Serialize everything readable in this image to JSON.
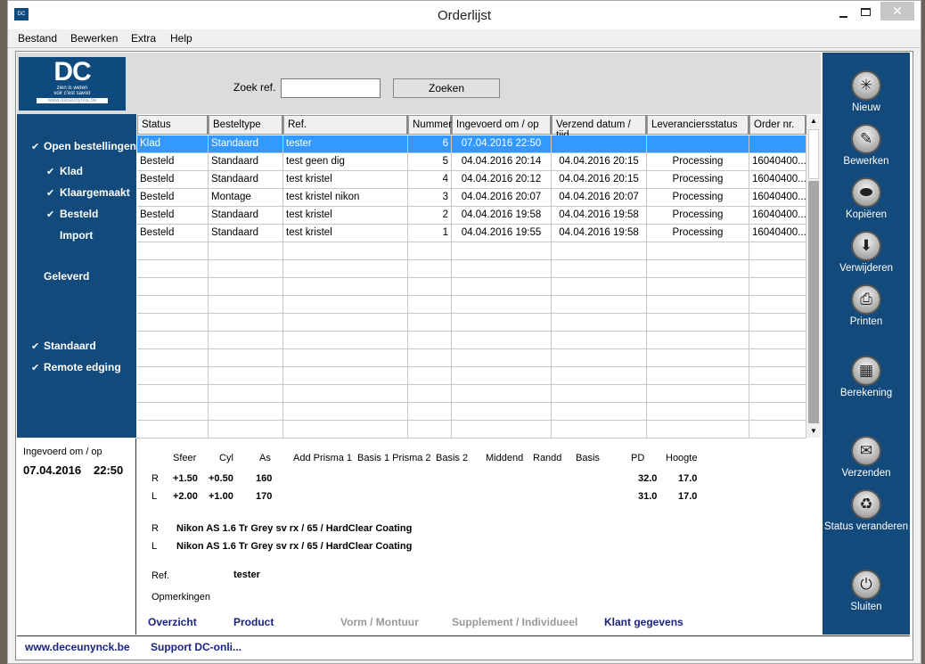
{
  "window": {
    "title": "Orderlijst",
    "app_icon": "DC"
  },
  "menu": [
    "Bestand",
    "Bewerken",
    "Extra",
    "Help"
  ],
  "logo": {
    "text": "DC",
    "tagline1": "zien is weten",
    "tagline2": "voir c'est savoir",
    "url": "www.deceunynck.be"
  },
  "search": {
    "label": "Zoek ref.",
    "value": "",
    "button": "Zoeken"
  },
  "sidebar": {
    "items": [
      {
        "label": "Open bestellingen",
        "checked": true
      },
      {
        "label": "Klad",
        "checked": true
      },
      {
        "label": "Klaargemaakt",
        "checked": true
      },
      {
        "label": "Besteld",
        "checked": true
      },
      {
        "label": "Import",
        "checked": false
      },
      {
        "label": "Geleverd",
        "checked": false
      },
      {
        "label": "Standaard",
        "checked": true
      },
      {
        "label": "Remote edging",
        "checked": true
      }
    ]
  },
  "table": {
    "columns": [
      "Status",
      "Besteltype",
      "Ref.",
      "Nummer",
      "Ingevoerd om / op",
      "Verzend datum / tijd",
      "Leveranciersstatus",
      "Order nr."
    ],
    "rows": [
      [
        "Klad",
        "Standaard",
        "tester",
        "6",
        "07.04.2016   22:50",
        "",
        "",
        ""
      ],
      [
        "Besteld",
        "Standaard",
        "test geen dig",
        "5",
        "04.04.2016   20:14",
        "04.04.2016   20:15",
        "Processing",
        "16040400..."
      ],
      [
        "Besteld",
        "Standaard",
        "test kristel",
        "4",
        "04.04.2016   20:12",
        "04.04.2016   20:15",
        "Processing",
        "16040400..."
      ],
      [
        "Besteld",
        "Montage",
        "test kristel nikon",
        "3",
        "04.04.2016   20:07",
        "04.04.2016   20:07",
        "Processing",
        "16040400..."
      ],
      [
        "Besteld",
        "Standaard",
        "test kristel",
        "2",
        "04.04.2016   19:58",
        "04.04.2016   19:58",
        "Processing",
        "16040400..."
      ],
      [
        "Besteld",
        "Standaard",
        "test kristel",
        "1",
        "04.04.2016   19:55",
        "04.04.2016   19:58",
        "Processing",
        "16040400..."
      ]
    ],
    "selected_row": 0
  },
  "actions": [
    {
      "label": "Nieuw",
      "icon": "new-icon",
      "glyph": "✳"
    },
    {
      "label": "Bewerken",
      "icon": "pencil-icon",
      "glyph": "✎"
    },
    {
      "label": "Kopiëren",
      "icon": "copy-icon",
      "glyph": "⬬"
    },
    {
      "label": "Verwijderen",
      "icon": "delete-icon",
      "glyph": "⬇"
    },
    {
      "label": "Printen",
      "icon": "printer-icon",
      "glyph": "⎙"
    },
    {
      "label": "Berekening",
      "icon": "calculator-icon",
      "glyph": "▦"
    },
    {
      "label": "Verzenden",
      "icon": "envelope-icon",
      "glyph": "✉"
    },
    {
      "label": "Status veranderen",
      "icon": "recycle-icon",
      "glyph": "♻"
    },
    {
      "label": "Sluiten",
      "icon": "power-icon",
      "glyph": "⏻"
    }
  ],
  "detail": {
    "entered_label": "Ingevoerd om / op",
    "entered_date": "07.04.2016",
    "entered_time": "22:50",
    "headers": [
      "Sfeer",
      "Cyl",
      "As",
      "Add Prisma 1",
      "Basis 1 Prisma 2",
      "Basis 2",
      "Middend",
      "Randd",
      "Basis",
      "PD",
      "Hoogte"
    ],
    "R": {
      "side": "R",
      "sfeer": "+1.50",
      "cyl": "+0.50",
      "as": "160",
      "pd": "32.0",
      "hoogte": "17.0"
    },
    "L": {
      "side": "L",
      "sfeer": "+2.00",
      "cyl": "+1.00",
      "as": "170",
      "pd": "31.0",
      "hoogte": "17.0"
    },
    "product_R": "Nikon AS 1.6 Tr Grey sv rx  /  65  /  HardClear Coating",
    "product_L": "Nikon AS 1.6 Tr Grey sv rx  /  65  /  HardClear Coating",
    "ref_label": "Ref.",
    "ref_value": "tester",
    "remarks_label": "Opmerkingen",
    "tabs": [
      {
        "label": "Overzicht",
        "enabled": true
      },
      {
        "label": "Product",
        "enabled": true
      },
      {
        "label": "Vorm / Montuur",
        "enabled": false
      },
      {
        "label": "Supplement / Individueel",
        "enabled": false
      },
      {
        "label": "Klant gegevens",
        "enabled": true
      }
    ]
  },
  "footer": {
    "website": "www.deceunynck.be",
    "support": "Support DC-onli..."
  },
  "colors": {
    "panel_blue": "#134a7c",
    "selection": "#3399ff",
    "link": "#1a237e"
  }
}
